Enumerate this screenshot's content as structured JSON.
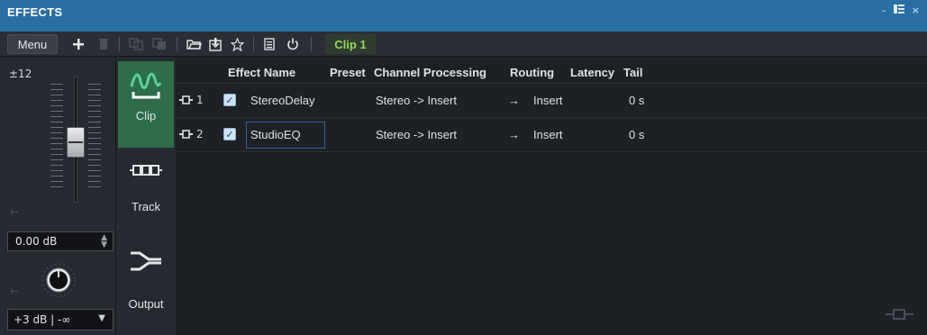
{
  "window": {
    "title": "EFFECTS",
    "controls": [
      "minimize-icon",
      "layout-icon",
      "close-icon"
    ]
  },
  "toolbar": {
    "menu_label": "Menu",
    "buttons": [
      "add-icon",
      "delete-icon",
      "copy-icon",
      "paste-icon",
      "open-folder-icon",
      "save-icon",
      "favorites-star-icon",
      "list-icon",
      "power-icon"
    ],
    "context_label": "Clip 1"
  },
  "gain": {
    "range_label": "±12",
    "value": "0.00 dB",
    "mix_value": "+3 dB | -∞"
  },
  "modes": [
    {
      "label": "Clip",
      "icon": "waveform-icon",
      "active": true
    },
    {
      "label": "Track",
      "icon": "track-chain-icon",
      "active": false
    },
    {
      "label": "Output",
      "icon": "output-icon",
      "active": false
    }
  ],
  "table": {
    "headers": {
      "effect_name": "Effect Name",
      "preset": "Preset",
      "channel_processing": "Channel Processing",
      "routing": "Routing",
      "latency": "Latency",
      "tail": "Tail"
    },
    "rows": [
      {
        "index": "1",
        "enabled": true,
        "effect_name": "StereoDelay",
        "preset": "",
        "channel_processing": "Stereo -> Insert",
        "routing": "Insert",
        "latency": "",
        "tail": "0 s"
      },
      {
        "index": "2",
        "enabled": true,
        "effect_name": "StudioEQ",
        "preset": "",
        "channel_processing": "Stereo -> Insert",
        "routing": "Insert",
        "latency": "",
        "tail": "0 s"
      }
    ]
  },
  "colors": {
    "title_bar": "#2a6fa3",
    "active_mode": "#2e6d4a",
    "clip_label": "#96d85a",
    "waveform_icon": "#5ad1a0"
  }
}
